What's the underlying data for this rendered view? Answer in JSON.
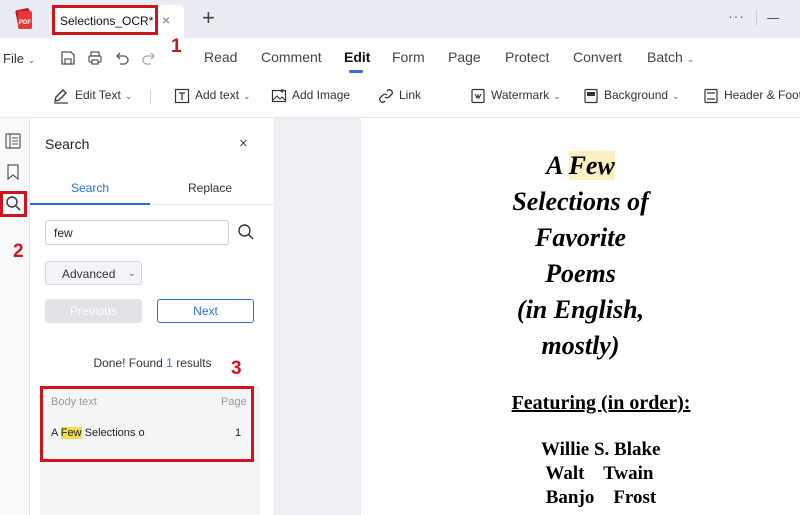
{
  "window": {
    "tab_title": "Selections_OCR*",
    "tab_close": "×",
    "new_tab": "+",
    "more": "···"
  },
  "menubar": {
    "file": "File",
    "items": [
      "Read",
      "Comment",
      "Edit",
      "Form",
      "Page",
      "Protect",
      "Convert",
      "Batch"
    ],
    "active": "Edit"
  },
  "toolbar": {
    "edit_text": "Edit Text",
    "add_text": "Add text",
    "add_image": "Add Image",
    "link": "Link",
    "watermark": "Watermark",
    "background": "Background",
    "header_footer": "Header & Footer"
  },
  "search_panel": {
    "title": "Search",
    "close": "×",
    "tab_search": "Search",
    "tab_replace": "Replace",
    "query": "few",
    "advanced": "Advanced",
    "previous": "Previous",
    "next": "Next",
    "found_prefix": "Done! Found ",
    "found_count": "1",
    "found_suffix": " results",
    "results_header_text": "Body text",
    "results_header_page": "Page",
    "results": [
      {
        "before": "A ",
        "match": "Few",
        "after": " Selections o",
        "page": "1"
      }
    ]
  },
  "document": {
    "title_pre": "A ",
    "title_match": "Few",
    "title_lines": [
      "Selections of",
      "Favorite",
      "Poems",
      "(in English,",
      "mostly)"
    ],
    "featuring": "Featuring (in order):",
    "authors": [
      "Willie S. Blake",
      " Walt    Twain",
      " Banjo    Frost"
    ]
  },
  "annotations": {
    "numbers": [
      "1",
      "2",
      "3"
    ],
    "color": "#d0141b"
  },
  "colors": {
    "accent": "#2b6fe0",
    "highlight": "#f6dc4c"
  }
}
